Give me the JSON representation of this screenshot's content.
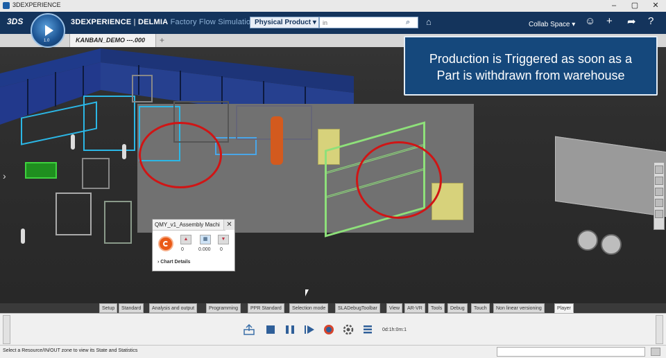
{
  "window": {
    "title": "3DEXPERIENCE"
  },
  "header": {
    "compass_version": "1.0",
    "brand_main": "3DEXPERIENCE",
    "brand_sep": " | ",
    "brand_product": "DELMIA",
    "brand_app": " Factory Flow Simulation",
    "search_scope": "Physical Product",
    "search_placeholder": "in",
    "collab_space": "Collab Space"
  },
  "tabs": {
    "doc_tab": "KANBAN_DEMO ---.000",
    "add": "+"
  },
  "callout": {
    "line1": "Production is Triggered as soon as a",
    "line2": "Part is withdrawn from warehouse"
  },
  "resource_panel": {
    "title": "QMY_v1_Assembly Machi",
    "close": "✕",
    "value_left": "0",
    "value_mid": "0.000",
    "value_right": "0",
    "details": "› Chart Details"
  },
  "section_tabs": [
    "Setup",
    "Standard",
    "Analysis and output",
    "Programming",
    "PPR Standard",
    "Selection mode",
    "SLADebugToolbar",
    "View",
    "AR-VR",
    "Tools",
    "Debug",
    "Touch",
    "Non linear versioning",
    "Player"
  ],
  "player": {
    "time": "0d:1h:0m:1"
  },
  "status": {
    "message": "Select a Resource/IN/OUT zone to view its State and Statistics"
  },
  "colors": {
    "header_bg": "#14345c",
    "callout_bg": "#15487c",
    "highlight_red": "#d01515",
    "rack_cyan": "#2bb7e6",
    "rack_green": "#8ee07a"
  }
}
